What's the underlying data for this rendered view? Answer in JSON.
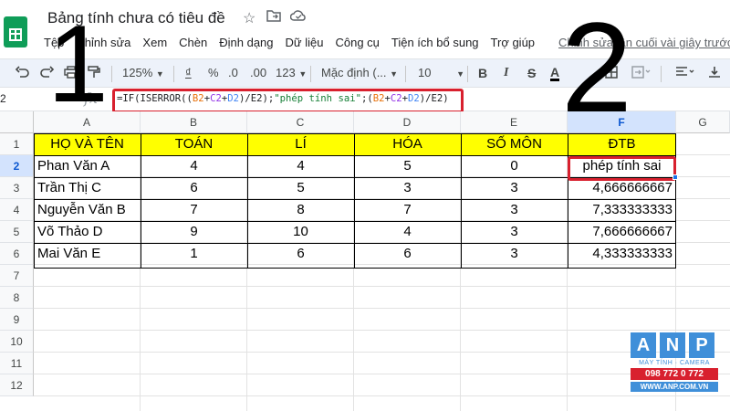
{
  "app": {
    "doc_title": "Bảng tính chưa có tiêu đề",
    "last_edit": "Chỉnh sửa lần cuối vài giây trước"
  },
  "menu": [
    "Tệp",
    "Chỉnh sửa",
    "Xem",
    "Chèn",
    "Định dạng",
    "Dữ liệu",
    "Công cụ",
    "Tiện ích bổ sung",
    "Trợ giúp"
  ],
  "toolbar": {
    "zoom": "125%",
    "currency": "₫",
    "percent": "%",
    "dec_decrease": ".0",
    "dec_increase": ".00",
    "number_format": "123",
    "font": "Mặc định (...",
    "font_size": "10",
    "bold": "B",
    "italic": "I",
    "strike": "S",
    "text_color": "A"
  },
  "formula_bar": {
    "cell_ref": "2",
    "fx": "fx",
    "formula": "=IF(ISERROR((B2+C2+D2)/E2);\"phép tính sai\";(B2+C2+D2)/E2)"
  },
  "sheet": {
    "columns": [
      "A",
      "B",
      "C",
      "D",
      "E",
      "F",
      "G"
    ],
    "rows": [
      "1",
      "2",
      "3",
      "4",
      "5",
      "6",
      "7",
      "8",
      "9",
      "10",
      "11",
      "12"
    ],
    "header": [
      "HỌ VÀ TÊN",
      "TOÁN",
      "LÍ",
      "HÓA",
      "SỐ MÔN",
      "ĐTB"
    ],
    "data": [
      [
        "Phan Văn A",
        "4",
        "4",
        "5",
        "0",
        "phép tính sai"
      ],
      [
        "Trần Thị C",
        "6",
        "5",
        "3",
        "3",
        "4,666666667"
      ],
      [
        "Nguyễn Văn B",
        "7",
        "8",
        "7",
        "3",
        "7,333333333"
      ],
      [
        "Võ Thảo D",
        "9",
        "10",
        "4",
        "3",
        "7,666666667"
      ],
      [
        "Mai Văn E",
        "1",
        "6",
        "6",
        "3",
        "4,333333333"
      ]
    ]
  },
  "annotations": {
    "step1": "1",
    "step2": "2"
  },
  "watermark": {
    "letters": [
      "A",
      "N",
      "P"
    ],
    "sub": "MÁY TÍNH · CAMERA",
    "phone": "098 772 0 772",
    "web": "WWW.ANP.COM.VN"
  },
  "colors": {
    "header_fill": "#ffff00",
    "highlight_red": "#d8202e",
    "sheets_green": "#0f9d58"
  }
}
